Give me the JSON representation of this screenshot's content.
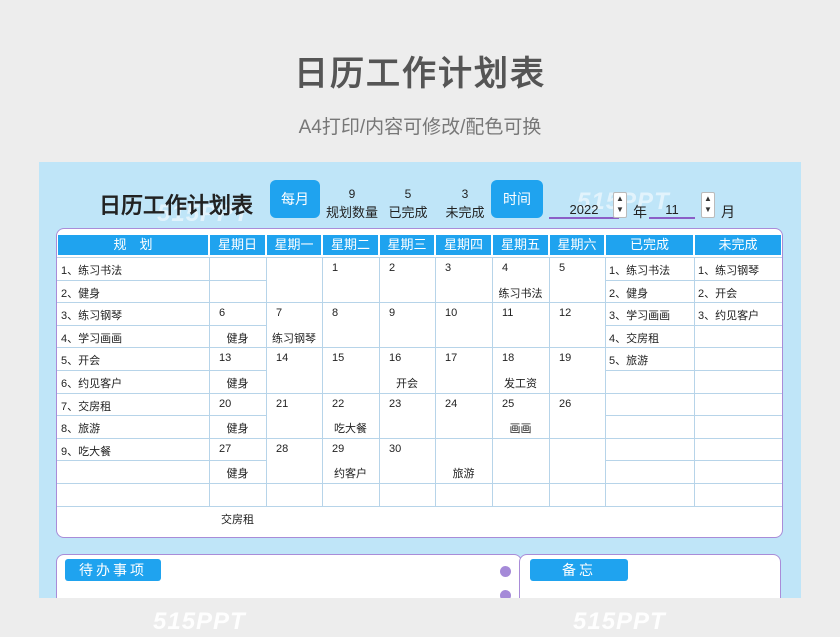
{
  "hero": {
    "title": "日历工作计划表",
    "subtitle": "A4打印/内容可修改/配色可换"
  },
  "sheet": {
    "title": "日历工作计划表",
    "monthly_label": "每月",
    "time_label": "时间",
    "stats": [
      {
        "value": "9",
        "label": "规划数量"
      },
      {
        "value": "5",
        "label": "已完成"
      },
      {
        "value": "3",
        "label": "未完成"
      }
    ],
    "year": "2022",
    "year_unit": "年",
    "month": "11",
    "month_unit": "月"
  },
  "calendar": {
    "headers": [
      "规　划",
      "星期日",
      "星期一",
      "星期二",
      "星期三",
      "星期四",
      "星期五",
      "星期六",
      "已完成",
      "未完成"
    ],
    "plans": [
      "1、练习书法",
      "2、健身",
      "3、练习钢琴",
      "4、学习画画",
      "5、开会",
      "6、约见客户",
      "7、交房租",
      "8、旅游",
      "9、吃大餐",
      "",
      ""
    ],
    "weeks": [
      [
        {
          "d": "",
          "t": ""
        },
        {
          "d": "",
          "t": ""
        },
        {
          "d": "1",
          "t": ""
        },
        {
          "d": "2",
          "t": ""
        },
        {
          "d": "3",
          "t": ""
        },
        {
          "d": "4",
          "t": "练习书法"
        },
        {
          "d": "5",
          "t": ""
        }
      ],
      [
        {
          "d": "6",
          "t": "健身"
        },
        {
          "d": "7",
          "t": "练习钢琴"
        },
        {
          "d": "8",
          "t": ""
        },
        {
          "d": "9",
          "t": ""
        },
        {
          "d": "10",
          "t": ""
        },
        {
          "d": "11",
          "t": ""
        },
        {
          "d": "12",
          "t": ""
        }
      ],
      [
        {
          "d": "13",
          "t": "健身"
        },
        {
          "d": "14",
          "t": ""
        },
        {
          "d": "15",
          "t": ""
        },
        {
          "d": "16",
          "t": "开会"
        },
        {
          "d": "17",
          "t": ""
        },
        {
          "d": "18",
          "t": "发工资"
        },
        {
          "d": "19",
          "t": ""
        }
      ],
      [
        {
          "d": "20",
          "t": "健身"
        },
        {
          "d": "21",
          "t": ""
        },
        {
          "d": "22",
          "t": "吃大餐"
        },
        {
          "d": "23",
          "t": ""
        },
        {
          "d": "24",
          "t": ""
        },
        {
          "d": "25",
          "t": "画画"
        },
        {
          "d": "26",
          "t": ""
        }
      ],
      [
        {
          "d": "27",
          "t": "健身"
        },
        {
          "d": "28",
          "t": ""
        },
        {
          "d": "29",
          "t": "约客户"
        },
        {
          "d": "30",
          "t": ""
        },
        {
          "d": "",
          "t": "旅游"
        },
        {
          "d": "",
          "t": ""
        },
        {
          "d": "",
          "t": ""
        }
      ],
      [
        {
          "d": "",
          "t": "交房租"
        },
        {
          "d": "",
          "t": ""
        },
        {
          "d": "",
          "t": ""
        },
        {
          "d": "",
          "t": ""
        },
        {
          "d": "",
          "t": ""
        },
        {
          "d": "",
          "t": ""
        },
        {
          "d": "",
          "t": ""
        }
      ]
    ],
    "completed": [
      "1、练习书法",
      "2、健身",
      "3、学习画画",
      "4、交房租",
      "5、旅游",
      "",
      "",
      "",
      "",
      "",
      ""
    ],
    "uncompleted": [
      "1、练习钢琴",
      "2、开会",
      "3、约见客户",
      "",
      "",
      "",
      "",
      "",
      "",
      "",
      ""
    ]
  },
  "todo": {
    "title": "待办事项"
  },
  "memo": {
    "title": "备忘"
  },
  "watermarks": [
    "515PPT",
    "515PPT",
    "515PPT",
    "515PPT"
  ],
  "colors": {
    "accent": "#1fa3ef",
    "sheet_bg": "#bfe5f8",
    "border": "#a98cd8"
  }
}
